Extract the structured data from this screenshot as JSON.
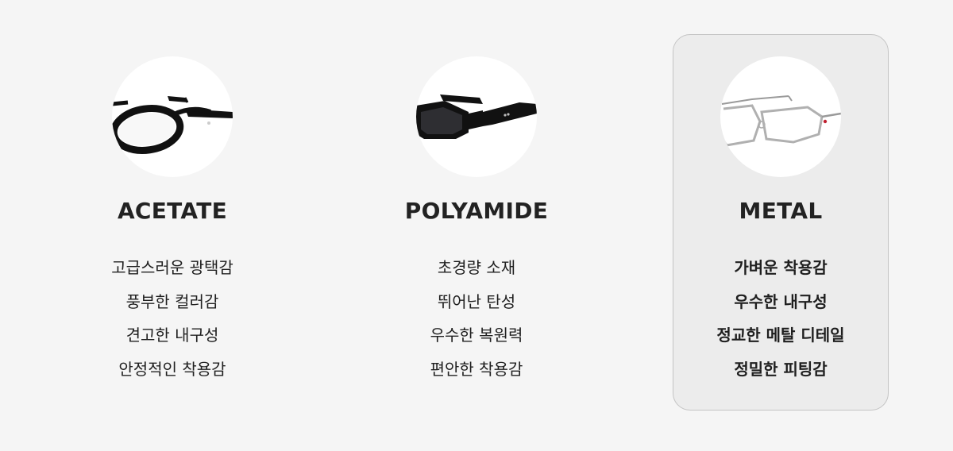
{
  "cards": [
    {
      "title": "ACETATE",
      "image_icon": "acetate-glasses-icon",
      "features": [
        "고급스러운 광택감",
        "풍부한 컬러감",
        "견고한 내구성",
        "안정적인 착용감"
      ]
    },
    {
      "title": "POLYAMIDE",
      "image_icon": "polyamide-sunglasses-icon",
      "features": [
        "초경량 소재",
        "뛰어난 탄성",
        "우수한 복원력",
        "편안한 착용감"
      ]
    },
    {
      "title": "METAL",
      "image_icon": "metal-glasses-icon",
      "highlighted": true,
      "features": [
        "가벼운 착용감",
        "우수한 내구성",
        "정교한 메탈 디테일",
        "정밀한 피팅감"
      ]
    }
  ],
  "colors": {
    "background": "#f5f5f5",
    "highlight_card": "#ececec",
    "highlight_border": "#c4c4c4",
    "text": "#222222"
  }
}
